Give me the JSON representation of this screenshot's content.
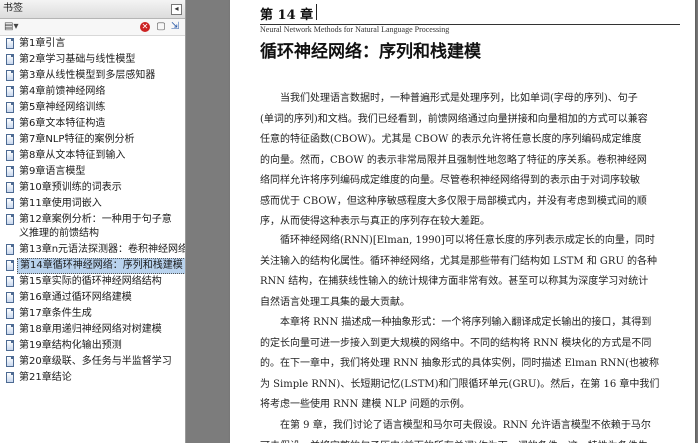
{
  "sidebar": {
    "title": "书签",
    "collapse_glyph": "◂",
    "toolbar": {
      "options_glyph": "▤▾",
      "delete_glyph": "✕",
      "new_glyph": "▢",
      "expand_glyph": "⇲"
    },
    "items": [
      {
        "label": "第1章引言"
      },
      {
        "label": "第2章学习基础与线性模型"
      },
      {
        "label": "第3章从线性模型到多层感知器"
      },
      {
        "label": "第4章前馈神经网络"
      },
      {
        "label": "第5章神经网络训练"
      },
      {
        "label": "第6章文本特征构造"
      },
      {
        "label": "第7章NLP特征的案例分析"
      },
      {
        "label": "第8章从文本特征到输入"
      },
      {
        "label": "第9章语言模型"
      },
      {
        "label": "第10章预训练的词表示"
      },
      {
        "label": "第11章使用词嵌入"
      },
      {
        "label": "第12章案例分析：一种用于句子意义推理的前馈结构"
      },
      {
        "label": "第13章n元语法探测器：卷积神经网络"
      },
      {
        "label": "第14章循环神经网络：序列和栈建模",
        "selected": true
      },
      {
        "label": "第15章实际的循环神经网络结构"
      },
      {
        "label": "第16章通过循环网络建模"
      },
      {
        "label": "第17章条件生成"
      },
      {
        "label": "第18章用递归神经网络对树建模"
      },
      {
        "label": "第19章结构化输出预测"
      },
      {
        "label": "第20章级联、多任务与半监督学习"
      },
      {
        "label": "第21章结论"
      }
    ]
  },
  "document": {
    "running_head": {
      "chapter": "第 14 章",
      "subtitle": "Neural Network Methods for Natural Language Processing"
    },
    "chapter_title": "循环神经网络：序列和栈建模",
    "paragraphs": [
      [
        "当我们处理语言数据时，一种普遍形式是处理序列，比如单词(字母的序列)、句子",
        "(单词的序列)和文档。我们已经看到，前馈网络通过向量拼接和向量相加的方式可以兼容",
        "任意的特征函数(CBOW)。尤其是 CBOW 的表示允许将任意长度的序列编码成定维度",
        "的向量。然而，CBOW 的表示非常局限并且强制性地忽略了特征的序关系。卷积神经网",
        "络同样允许将序列编码成定维度的向量。尽管卷积神经网络得到的表示由于对词序较敏",
        "感而优于 CBOW，但这种序敏感程度大多仅限于局部模式内，并没有考虑到模式间的顺",
        "序，从而使得这种表示与真正的序列存在较大差距。"
      ],
      [
        "循环神经网络(RNN)[Elman, 1990]可以将任意长度的序列表示成定长的向量，同时",
        "关注输入的结构化属性。循环神经网络，尤其是那些带有门结构如 LSTM 和 GRU 的各种",
        "RNN 结构，在捕获线性输入的统计规律方面非常有效。甚至可以称其为深度学习对统计",
        "自然语言处理工具集的最大贡献。"
      ],
      [
        "本章将 RNN 描述成一种抽象形式：一个将序列输入翻译成定长输出的接口，其得到",
        "的定长向量可进一步接入到更大规模的网络中。不同的结构将 RNN 模块化的方式是不同",
        "的。在下一章中，我们将处理 RNN 抽象形式的具体实例，同时描述 Elman RNN(也被称",
        "为 Simple RNN)、长短期记忆(LSTM)和门限循环单元(GRU)。然后，在第 16 章中我们",
        "将考虑一些使用 RNN 建模 NLP 问题的示例。"
      ],
      [
        "在第 9 章，我们讨论了语言模型和马尔可夫假设。RNN 允许语言模型不依赖于马尔",
        "可夫假设，并将完整的句子历史(前面的所有单词)作为下一词的条件。这一特性为条件生"
      ]
    ]
  }
}
